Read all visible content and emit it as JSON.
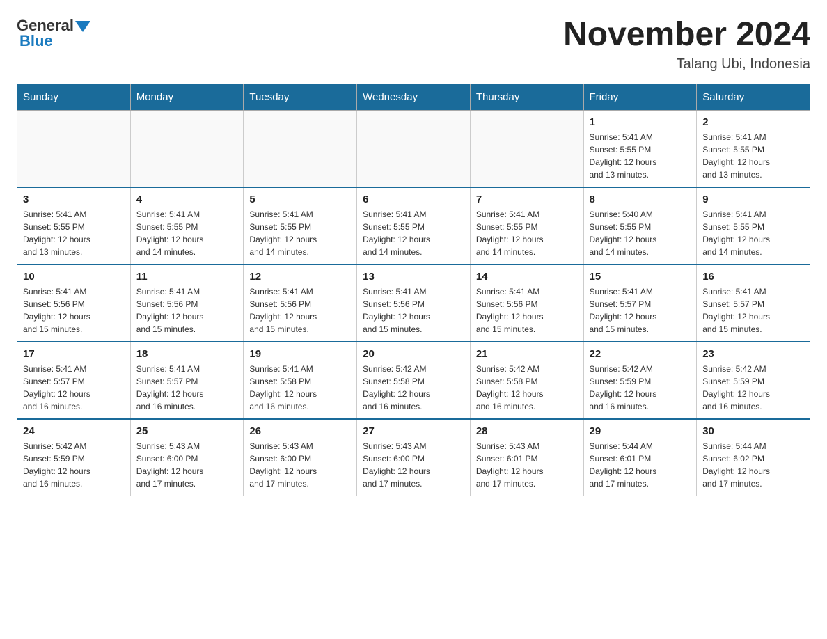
{
  "header": {
    "logo_general": "General",
    "logo_blue": "Blue",
    "month_title": "November 2024",
    "location": "Talang Ubi, Indonesia"
  },
  "days_of_week": [
    "Sunday",
    "Monday",
    "Tuesday",
    "Wednesday",
    "Thursday",
    "Friday",
    "Saturday"
  ],
  "weeks": [
    [
      {
        "day": "",
        "info": ""
      },
      {
        "day": "",
        "info": ""
      },
      {
        "day": "",
        "info": ""
      },
      {
        "day": "",
        "info": ""
      },
      {
        "day": "",
        "info": ""
      },
      {
        "day": "1",
        "info": "Sunrise: 5:41 AM\nSunset: 5:55 PM\nDaylight: 12 hours\nand 13 minutes."
      },
      {
        "day": "2",
        "info": "Sunrise: 5:41 AM\nSunset: 5:55 PM\nDaylight: 12 hours\nand 13 minutes."
      }
    ],
    [
      {
        "day": "3",
        "info": "Sunrise: 5:41 AM\nSunset: 5:55 PM\nDaylight: 12 hours\nand 13 minutes."
      },
      {
        "day": "4",
        "info": "Sunrise: 5:41 AM\nSunset: 5:55 PM\nDaylight: 12 hours\nand 14 minutes."
      },
      {
        "day": "5",
        "info": "Sunrise: 5:41 AM\nSunset: 5:55 PM\nDaylight: 12 hours\nand 14 minutes."
      },
      {
        "day": "6",
        "info": "Sunrise: 5:41 AM\nSunset: 5:55 PM\nDaylight: 12 hours\nand 14 minutes."
      },
      {
        "day": "7",
        "info": "Sunrise: 5:41 AM\nSunset: 5:55 PM\nDaylight: 12 hours\nand 14 minutes."
      },
      {
        "day": "8",
        "info": "Sunrise: 5:40 AM\nSunset: 5:55 PM\nDaylight: 12 hours\nand 14 minutes."
      },
      {
        "day": "9",
        "info": "Sunrise: 5:41 AM\nSunset: 5:55 PM\nDaylight: 12 hours\nand 14 minutes."
      }
    ],
    [
      {
        "day": "10",
        "info": "Sunrise: 5:41 AM\nSunset: 5:56 PM\nDaylight: 12 hours\nand 15 minutes."
      },
      {
        "day": "11",
        "info": "Sunrise: 5:41 AM\nSunset: 5:56 PM\nDaylight: 12 hours\nand 15 minutes."
      },
      {
        "day": "12",
        "info": "Sunrise: 5:41 AM\nSunset: 5:56 PM\nDaylight: 12 hours\nand 15 minutes."
      },
      {
        "day": "13",
        "info": "Sunrise: 5:41 AM\nSunset: 5:56 PM\nDaylight: 12 hours\nand 15 minutes."
      },
      {
        "day": "14",
        "info": "Sunrise: 5:41 AM\nSunset: 5:56 PM\nDaylight: 12 hours\nand 15 minutes."
      },
      {
        "day": "15",
        "info": "Sunrise: 5:41 AM\nSunset: 5:57 PM\nDaylight: 12 hours\nand 15 minutes."
      },
      {
        "day": "16",
        "info": "Sunrise: 5:41 AM\nSunset: 5:57 PM\nDaylight: 12 hours\nand 15 minutes."
      }
    ],
    [
      {
        "day": "17",
        "info": "Sunrise: 5:41 AM\nSunset: 5:57 PM\nDaylight: 12 hours\nand 16 minutes."
      },
      {
        "day": "18",
        "info": "Sunrise: 5:41 AM\nSunset: 5:57 PM\nDaylight: 12 hours\nand 16 minutes."
      },
      {
        "day": "19",
        "info": "Sunrise: 5:41 AM\nSunset: 5:58 PM\nDaylight: 12 hours\nand 16 minutes."
      },
      {
        "day": "20",
        "info": "Sunrise: 5:42 AM\nSunset: 5:58 PM\nDaylight: 12 hours\nand 16 minutes."
      },
      {
        "day": "21",
        "info": "Sunrise: 5:42 AM\nSunset: 5:58 PM\nDaylight: 12 hours\nand 16 minutes."
      },
      {
        "day": "22",
        "info": "Sunrise: 5:42 AM\nSunset: 5:59 PM\nDaylight: 12 hours\nand 16 minutes."
      },
      {
        "day": "23",
        "info": "Sunrise: 5:42 AM\nSunset: 5:59 PM\nDaylight: 12 hours\nand 16 minutes."
      }
    ],
    [
      {
        "day": "24",
        "info": "Sunrise: 5:42 AM\nSunset: 5:59 PM\nDaylight: 12 hours\nand 16 minutes."
      },
      {
        "day": "25",
        "info": "Sunrise: 5:43 AM\nSunset: 6:00 PM\nDaylight: 12 hours\nand 17 minutes."
      },
      {
        "day": "26",
        "info": "Sunrise: 5:43 AM\nSunset: 6:00 PM\nDaylight: 12 hours\nand 17 minutes."
      },
      {
        "day": "27",
        "info": "Sunrise: 5:43 AM\nSunset: 6:00 PM\nDaylight: 12 hours\nand 17 minutes."
      },
      {
        "day": "28",
        "info": "Sunrise: 5:43 AM\nSunset: 6:01 PM\nDaylight: 12 hours\nand 17 minutes."
      },
      {
        "day": "29",
        "info": "Sunrise: 5:44 AM\nSunset: 6:01 PM\nDaylight: 12 hours\nand 17 minutes."
      },
      {
        "day": "30",
        "info": "Sunrise: 5:44 AM\nSunset: 6:02 PM\nDaylight: 12 hours\nand 17 minutes."
      }
    ]
  ]
}
